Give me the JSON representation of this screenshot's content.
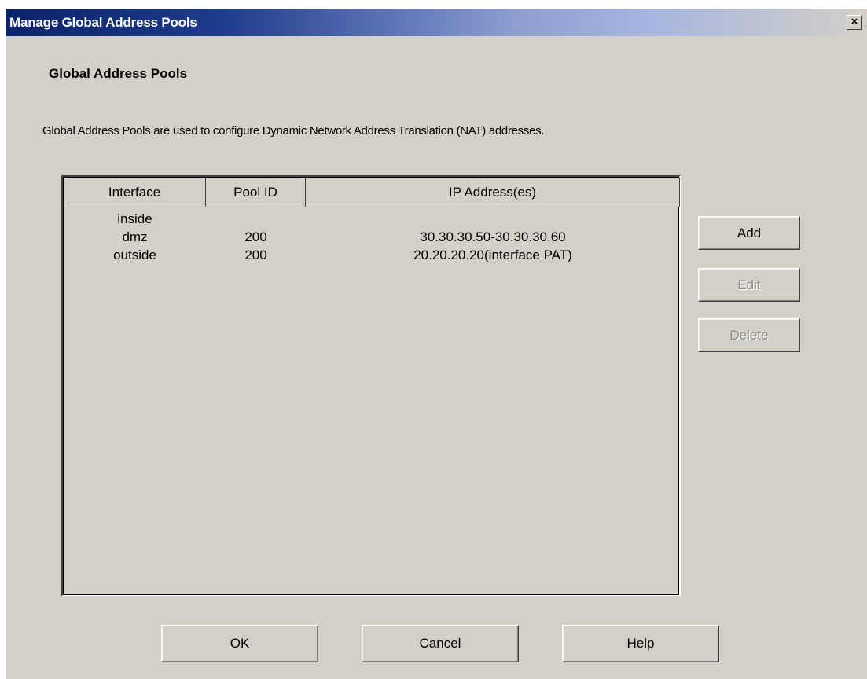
{
  "window": {
    "title": "Manage Global Address Pools",
    "close_label": "×"
  },
  "section": {
    "title": "Global Address Pools",
    "description": "Global Address Pools are used to configure Dynamic Network Address Translation (NAT) addresses."
  },
  "table": {
    "columns": [
      "Interface",
      "Pool ID",
      "IP Address(es)"
    ],
    "rows": [
      {
        "interface": "inside",
        "pool_id": "",
        "ip": ""
      },
      {
        "interface": "dmz",
        "pool_id": "200",
        "ip": "30.30.30.50-30.30.30.60"
      },
      {
        "interface": "outside",
        "pool_id": "200",
        "ip": "20.20.20.20(interface PAT)"
      }
    ]
  },
  "side_buttons": {
    "add": "Add",
    "edit": "Edit",
    "delete": "Delete"
  },
  "footer_buttons": {
    "ok": "OK",
    "cancel": "Cancel",
    "help": "Help"
  }
}
